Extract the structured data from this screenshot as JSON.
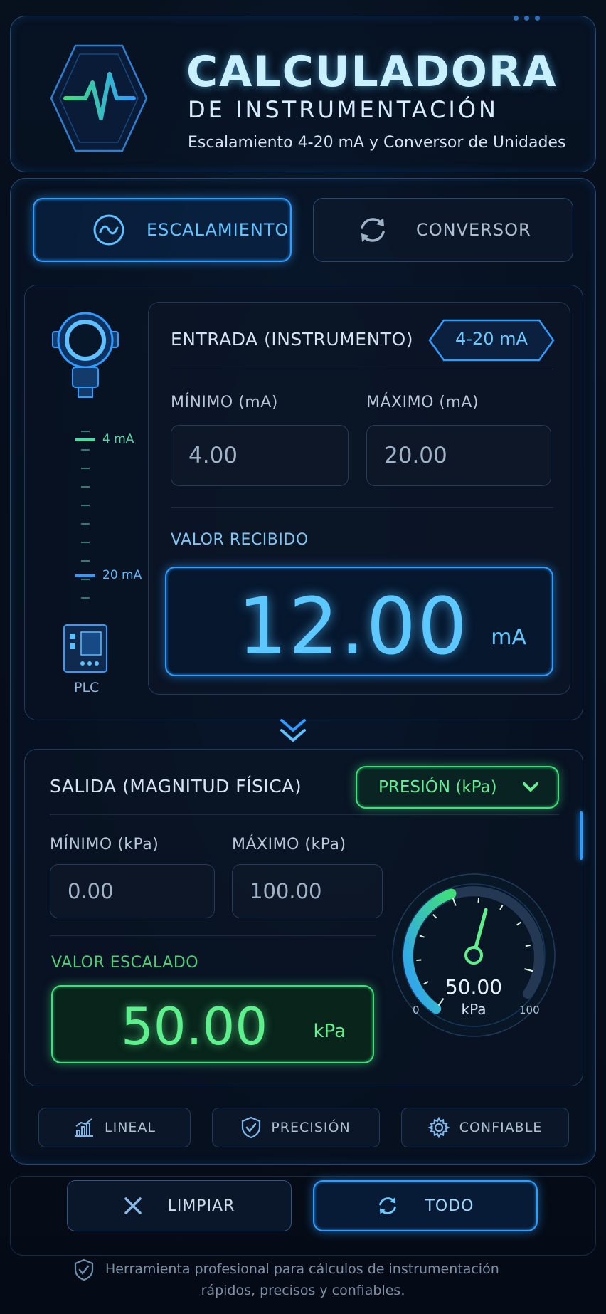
{
  "header": {
    "title": "CALCULADORA",
    "subtitle": "DE INSTRUMENTACIÓN",
    "tagline": "Escalamiento 4-20 mA y Conversor de Unidades"
  },
  "tabs": [
    {
      "label": "ESCALAMIENTO",
      "active": true,
      "icon": "wave-circle-icon"
    },
    {
      "label": "CONVERSOR",
      "active": false,
      "icon": "refresh-arrows-icon"
    }
  ],
  "input": {
    "title": "ENTRADA (INSTRUMENTO)",
    "badge": "4-20 mA",
    "min_label": "MÍNIMO (mA)",
    "min_value": "4.00",
    "max_label": "MÁXIMO (mA)",
    "max_value": "20.00",
    "received_label": "VALOR RECIBIDO",
    "received_value": "12.00",
    "received_unit": "mA"
  },
  "loop": {
    "tick_top": "4 mA",
    "tick_bottom": "20 mA",
    "plc_label": "PLC"
  },
  "output": {
    "title": "SALIDA (MAGNITUD FÍSICA)",
    "magnitude_select": "PRESIÓN (kPa)",
    "min_label": "MÍNIMO (kPa)",
    "min_value": "0.00",
    "max_label": "MÁXIMO (kPa)",
    "max_value": "100.00",
    "scaled_label": "VALOR ESCALADO",
    "scaled_value": "50.00",
    "scaled_unit": "kPa"
  },
  "gauge": {
    "value": "50.00",
    "unit": "kPa",
    "min": "0",
    "max": "100",
    "fraction": 0.5
  },
  "features": [
    {
      "label": "LINEAL",
      "icon": "bar-chart-icon"
    },
    {
      "label": "PRECISIÓN",
      "icon": "shield-check-icon"
    },
    {
      "label": "CONFIABLE",
      "icon": "gear-icon"
    }
  ],
  "actions": {
    "clear_label": "LIMPIAR",
    "all_label": "TODO"
  },
  "footer": {
    "line1": "Herramienta profesional para cálculos de instrumentación",
    "line2": "rápidos, precisos y confiables."
  },
  "colors": {
    "accent_blue": "#2f9cff",
    "accent_green": "#3fe07a",
    "background": "#060d18"
  }
}
